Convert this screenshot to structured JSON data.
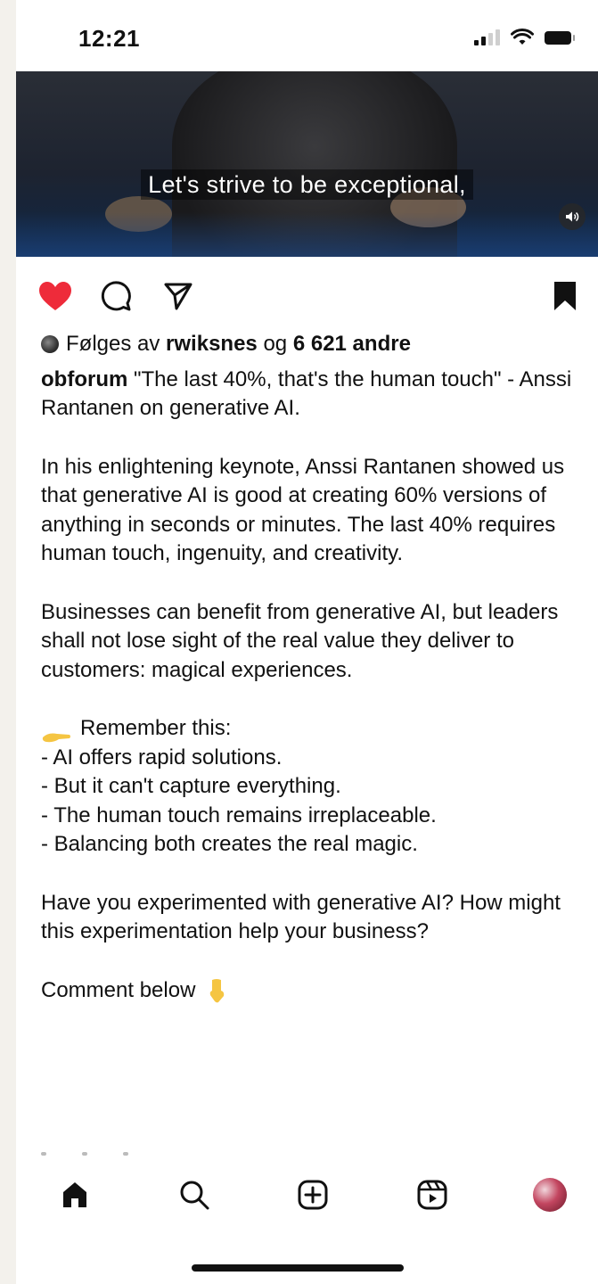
{
  "status_bar": {
    "time": "12:21"
  },
  "video": {
    "caption": "Let's strive to be exceptional,"
  },
  "post": {
    "followed_by": {
      "prefix": "Følges av",
      "user": "rwiksnes",
      "joiner": "og",
      "others": "6 621 andre"
    },
    "author": "obforum",
    "caption_lines": {
      "headline": "\"The last 40%, that's the human touch\" - Anssi Rantanen on generative AI.",
      "p1": "In his enlightening keynote, Anssi Rantanen showed us that generative AI is good at creating 60% versions of anything in seconds or minutes. The last 40% requires human touch, ingenuity, and creativity.",
      "p2": "Businesses can benefit from generative AI, but leaders shall not lose sight of the real value they deliver to customers: magical experiences.",
      "remember": "Remember this:",
      "bullets": [
        "- AI offers rapid solutions.",
        "- But it can't capture everything.",
        "- The human touch remains irreplaceable.",
        "- Balancing both creates the real magic."
      ],
      "question": "Have you experimented with generative AI? How might this experimentation help your business?",
      "comment_below": "Comment below"
    }
  },
  "icons": {
    "like": "heart-icon",
    "comment": "comment-icon",
    "share": "send-icon",
    "save": "bookmark-icon",
    "nav": [
      "home-icon",
      "search-icon",
      "create-icon",
      "reels-icon",
      "profile-avatar"
    ]
  },
  "colors": {
    "like_red": "#ee2b3a",
    "emoji_yellow": "#f5c542"
  }
}
